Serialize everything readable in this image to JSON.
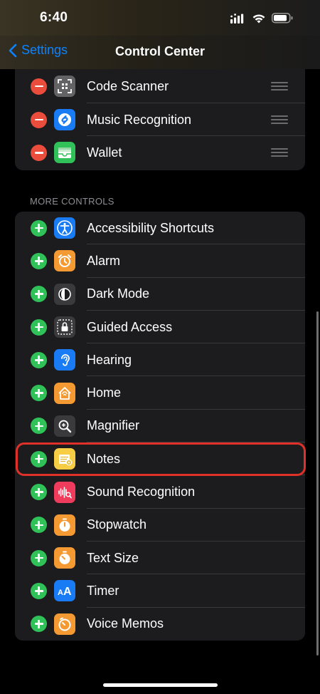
{
  "status_bar": {
    "time": "6:40"
  },
  "nav": {
    "back_label": "Settings",
    "title": "Control Center"
  },
  "included_controls": [
    {
      "label": "Code Scanner",
      "icon": "qr-code-icon"
    },
    {
      "label": "Music Recognition",
      "icon": "shazam-icon"
    },
    {
      "label": "Wallet",
      "icon": "wallet-icon"
    }
  ],
  "more_controls": {
    "header": "MORE CONTROLS",
    "items": [
      {
        "label": "Accessibility Shortcuts",
        "icon": "accessibility-icon"
      },
      {
        "label": "Alarm",
        "icon": "alarm-clock-icon"
      },
      {
        "label": "Dark Mode",
        "icon": "dark-mode-icon"
      },
      {
        "label": "Guided Access",
        "icon": "lock-icon"
      },
      {
        "label": "Hearing",
        "icon": "ear-icon"
      },
      {
        "label": "Home",
        "icon": "house-icon"
      },
      {
        "label": "Magnifier",
        "icon": "magnifier-icon"
      },
      {
        "label": "Notes",
        "icon": "notes-icon",
        "highlighted": true
      },
      {
        "label": "Sound Recognition",
        "icon": "sound-wave-icon"
      },
      {
        "label": "Stopwatch",
        "icon": "stopwatch-icon"
      },
      {
        "label": "Text Size",
        "icon": "text-size-icon"
      },
      {
        "label": "Timer",
        "icon": "timer-icon"
      },
      {
        "label": "Voice Memos",
        "icon": "voice-memos-icon"
      }
    ]
  },
  "colors": {
    "accent": "#0a84ff",
    "remove": "#eb4d3d",
    "add": "#30c158",
    "highlight": "#e0302a"
  }
}
